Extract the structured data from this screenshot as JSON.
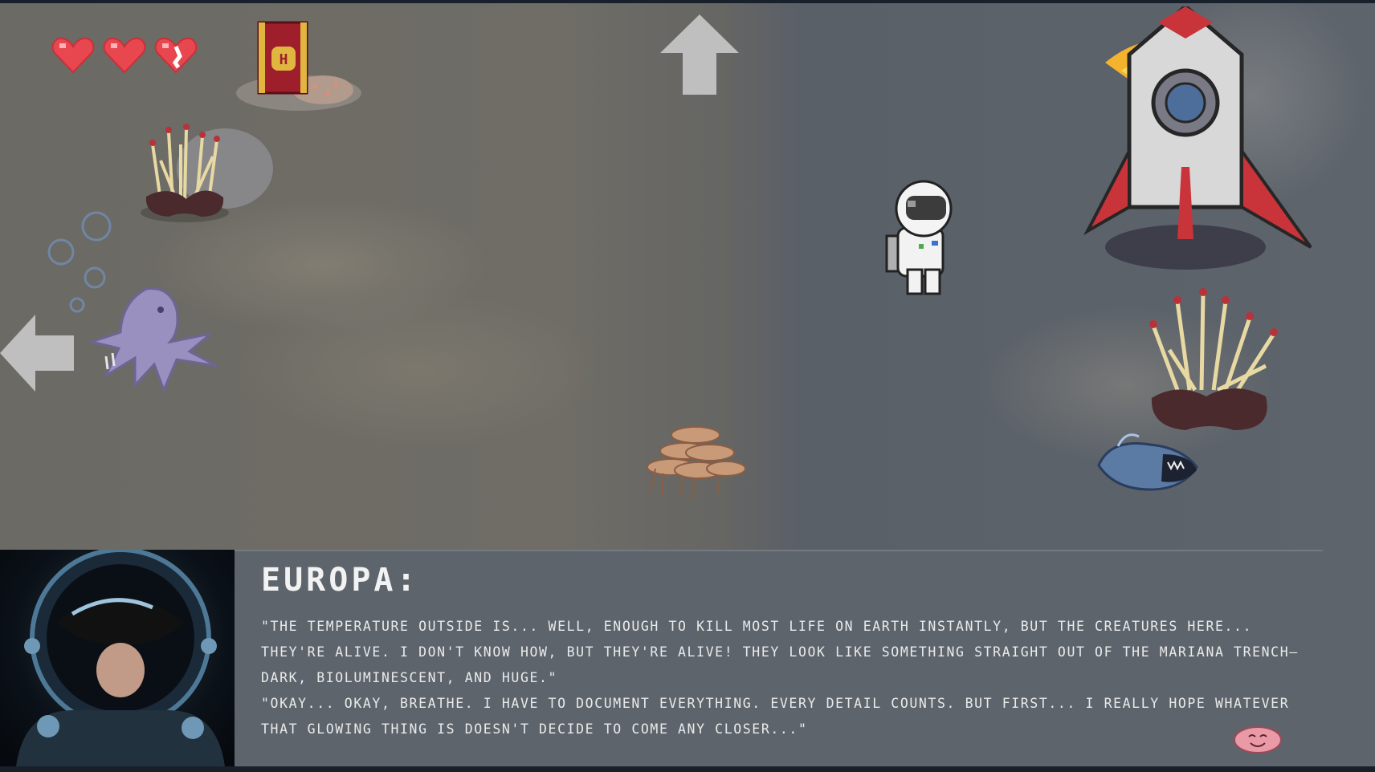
{
  "hud": {
    "hearts": [
      "heart-full",
      "heart-full",
      "heart-partial"
    ],
    "journal_icon": "journal-book-icon"
  },
  "navigation": {
    "up_arrow": "arrow-up-icon",
    "left_arrow": "arrow-left-icon"
  },
  "scene": {
    "creatures": [
      "octopus",
      "shrimp-swarm",
      "anglerfish",
      "astronaut",
      "rocket",
      "coral",
      "coral"
    ]
  },
  "dialog": {
    "speaker": "EUROPA:",
    "lines": [
      "\"The temperature outside is... well, enough to kill most life on Earth instantly, but the creatures here... they're alive. I don't know how, but they're alive! They look like something straight out of the Mariana Trench—dark, bioluminescent, and huge.\"",
      "\"Okay... okay, breathe. I have to document everything. Every detail counts. But first... I really hope whatever that glowing thing is doesn't decide to come any closer...\""
    ],
    "continue_icon": "blob-fish-icon"
  },
  "colors": {
    "heart": "#e8474f",
    "dialog_bg": "#5d646c",
    "text": "#eaeaea",
    "rocket_accent": "#c8343a"
  }
}
